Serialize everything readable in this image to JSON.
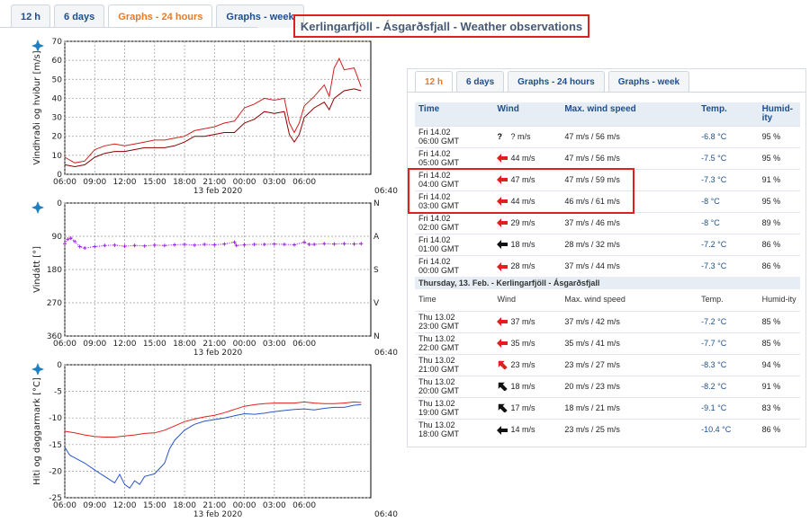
{
  "top_tabs": [
    {
      "label": "12 h",
      "active": false
    },
    {
      "label": "6 days",
      "active": false
    },
    {
      "label": "Graphs - 24 hours",
      "active": true
    },
    {
      "label": "Graphs - week",
      "active": false
    }
  ],
  "page_title": "Kerlingarfjöll - Ásgarðsfjall - Weather observations",
  "x_ticks": [
    "06:00",
    "09:00",
    "12:00",
    "15:00",
    "18:00",
    "21:00",
    "00:00",
    "03:00",
    "06:00"
  ],
  "x_date": "13 feb 2020",
  "x_end": "06:40",
  "colors": {
    "wind_mean": "#8b0000",
    "wind_gust": "#d21f1f",
    "direction": "#a020f0",
    "temp": "#e0201e",
    "dewpoint": "#2a56c6",
    "accent": "#e47b2c",
    "link": "#1f4e8c"
  },
  "chart_data": [
    {
      "type": "line",
      "ylabel": "Vindhraði og hviður [m/s]",
      "ylim": [
        0,
        70
      ],
      "yticks": [
        0,
        10,
        20,
        30,
        40,
        50,
        60,
        70
      ],
      "grid": true,
      "series": [
        {
          "values": [
            [
              0,
              5
            ],
            [
              1,
              4
            ],
            [
              2,
              5
            ],
            [
              3,
              9
            ],
            [
              4,
              11
            ],
            [
              5,
              12
            ],
            [
              6,
              12
            ],
            [
              7,
              13
            ],
            [
              8,
              14
            ],
            [
              9,
              14
            ],
            [
              10,
              14
            ],
            [
              11,
              15
            ],
            [
              12,
              17
            ],
            [
              13,
              20
            ],
            [
              14,
              20
            ],
            [
              15,
              21
            ],
            [
              16,
              22
            ],
            [
              17,
              22
            ],
            [
              18,
              27
            ],
            [
              19,
              29
            ],
            [
              20,
              33
            ],
            [
              21,
              32
            ],
            [
              22,
              33
            ],
            [
              22.5,
              21
            ],
            [
              23,
              17
            ],
            [
              23.5,
              21
            ],
            [
              24,
              30
            ],
            [
              25,
              35
            ],
            [
              26,
              38
            ],
            [
              26.5,
              34
            ],
            [
              27,
              40
            ],
            [
              27.5,
              42
            ],
            [
              28,
              44
            ],
            [
              29,
              45
            ],
            [
              29.7,
              44
            ]
          ]
        },
        {
          "values": [
            [
              0,
              9
            ],
            [
              1,
              6
            ],
            [
              2,
              7
            ],
            [
              3,
              13
            ],
            [
              4,
              15
            ],
            [
              5,
              16
            ],
            [
              6,
              15
            ],
            [
              7,
              16
            ],
            [
              8,
              17
            ],
            [
              9,
              18
            ],
            [
              10,
              18
            ],
            [
              11,
              19
            ],
            [
              12,
              20
            ],
            [
              13,
              23
            ],
            [
              14,
              24
            ],
            [
              15,
              25
            ],
            [
              16,
              27
            ],
            [
              17,
              28
            ],
            [
              18,
              35
            ],
            [
              19,
              37
            ],
            [
              20,
              40
            ],
            [
              21,
              39
            ],
            [
              22,
              40
            ],
            [
              22.5,
              27
            ],
            [
              23,
              22
            ],
            [
              23.5,
              27
            ],
            [
              24,
              36
            ],
            [
              25,
              41
            ],
            [
              26,
              47
            ],
            [
              26.5,
              41
            ],
            [
              27,
              56
            ],
            [
              27.5,
              61
            ],
            [
              28,
              55
            ],
            [
              29,
              56
            ],
            [
              29.7,
              46
            ]
          ]
        }
      ]
    },
    {
      "type": "scatter",
      "ylabel": "Vindátt [°]",
      "ylim": [
        360,
        0
      ],
      "yticks": [
        0,
        90,
        180,
        270,
        360
      ],
      "y2ticks": [
        "N",
        "A",
        "S",
        "V",
        "N"
      ],
      "grid": true,
      "series": [
        {
          "values": [
            [
              0,
              110
            ],
            [
              0.3,
              98
            ],
            [
              0.6,
              95
            ],
            [
              1,
              104
            ],
            [
              1.5,
              118
            ],
            [
              2,
              122
            ],
            [
              3,
              118
            ],
            [
              4,
              115
            ],
            [
              5,
              114
            ],
            [
              6,
              117
            ],
            [
              7,
              115
            ],
            [
              8,
              116
            ],
            [
              9,
              114
            ],
            [
              10,
              115
            ],
            [
              11,
              113
            ],
            [
              12,
              112
            ],
            [
              13,
              114
            ],
            [
              14,
              112
            ],
            [
              15,
              113
            ],
            [
              16,
              111
            ],
            [
              17,
              106
            ],
            [
              17.2,
              115
            ],
            [
              18,
              113
            ],
            [
              19,
              112
            ],
            [
              20,
              112
            ],
            [
              21,
              111
            ],
            [
              22,
              112
            ],
            [
              23,
              113
            ],
            [
              24,
              106
            ],
            [
              24.5,
              112
            ],
            [
              25,
              112
            ],
            [
              26,
              110
            ],
            [
              27,
              111
            ],
            [
              28,
              110
            ],
            [
              29,
              111
            ],
            [
              29.7,
              110
            ]
          ]
        }
      ]
    },
    {
      "type": "line",
      "ylabel": "Hiti og daggarmark [°C]",
      "ylim": [
        -25,
        0
      ],
      "yticks": [
        -25,
        -20,
        -15,
        -10,
        -5,
        0
      ],
      "grid": true,
      "series": [
        {
          "values": [
            [
              0,
              -12.5
            ],
            [
              1,
              -12.8
            ],
            [
              2,
              -13.2
            ],
            [
              3,
              -13.5
            ],
            [
              4,
              -13.6
            ],
            [
              5,
              -13.6
            ],
            [
              6,
              -13.4
            ],
            [
              7,
              -13.2
            ],
            [
              8,
              -12.9
            ],
            [
              9,
              -12.8
            ],
            [
              10,
              -12.3
            ],
            [
              11,
              -11.5
            ],
            [
              12,
              -10.7
            ],
            [
              13,
              -10.2
            ],
            [
              14,
              -9.8
            ],
            [
              15,
              -9.5
            ],
            [
              16,
              -9.0
            ],
            [
              17,
              -8.4
            ],
            [
              18,
              -7.8
            ],
            [
              19,
              -7.5
            ],
            [
              20,
              -7.3
            ],
            [
              21,
              -7.2
            ],
            [
              22,
              -7.2
            ],
            [
              23,
              -7.2
            ],
            [
              24,
              -7.0
            ],
            [
              25,
              -7.2
            ],
            [
              26,
              -7.3
            ],
            [
              27,
              -7.3
            ],
            [
              28,
              -7.2
            ],
            [
              29,
              -7.0
            ],
            [
              29.7,
              -7.1
            ]
          ]
        },
        {
          "values": [
            [
              0,
              -15.5
            ],
            [
              0.5,
              -17.0
            ],
            [
              1,
              -17.5
            ],
            [
              2,
              -18.5
            ],
            [
              3,
              -19.8
            ],
            [
              4,
              -21.0
            ],
            [
              5,
              -22.2
            ],
            [
              5.5,
              -20.6
            ],
            [
              6,
              -22.5
            ],
            [
              6.5,
              -23.2
            ],
            [
              7,
              -21.8
            ],
            [
              7.5,
              -22.5
            ],
            [
              8,
              -21.0
            ],
            [
              9,
              -20.5
            ],
            [
              10,
              -18.5
            ],
            [
              10.5,
              -15.8
            ],
            [
              11,
              -14.2
            ],
            [
              12,
              -12.3
            ],
            [
              13,
              -11.2
            ],
            [
              14,
              -10.6
            ],
            [
              15,
              -10.3
            ],
            [
              16,
              -10.0
            ],
            [
              17,
              -9.6
            ],
            [
              18,
              -9.2
            ],
            [
              19,
              -9.3
            ],
            [
              20,
              -9.1
            ],
            [
              21,
              -8.8
            ],
            [
              22,
              -8.6
            ],
            [
              23,
              -8.4
            ],
            [
              24,
              -8.3
            ],
            [
              25,
              -8.5
            ],
            [
              26,
              -8.2
            ],
            [
              27,
              -8.0
            ],
            [
              28,
              -8.0
            ],
            [
              29,
              -7.6
            ],
            [
              29.7,
              -7.5
            ]
          ]
        }
      ]
    }
  ],
  "panel": {
    "tabs": [
      {
        "label": "12 h",
        "active": true
      },
      {
        "label": "6 days",
        "active": false
      },
      {
        "label": "Graphs - 24 hours",
        "active": false
      },
      {
        "label": "Graphs - week",
        "active": false
      }
    ],
    "headers": {
      "time": "Time",
      "wind": "Wind",
      "max": "Max. wind speed",
      "temp": "Temp.",
      "humid": "Humid-ity"
    },
    "rows": [
      {
        "d": "Fri 14.02",
        "t": "06:00 GMT",
        "arrow": "unknown",
        "wind": "? m/s",
        "max": "47 m/s  /  56 m/s",
        "temp": "-6.8 °C",
        "hum": "95 %"
      },
      {
        "d": "Fri 14.02",
        "t": "05:00 GMT",
        "arrow": "red",
        "wind": "44 m/s",
        "max": "47 m/s  /  56 m/s",
        "temp": "-7.5 °C",
        "hum": "95 %"
      },
      {
        "d": "Fri 14.02",
        "t": "04:00 GMT",
        "arrow": "red",
        "wind": "47 m/s",
        "max": "47 m/s  /  59 m/s",
        "temp": "-7.3 °C",
        "hum": "91 %"
      },
      {
        "d": "Fri 14.02",
        "t": "03:00 GMT",
        "arrow": "red",
        "wind": "44 m/s",
        "max": "46 m/s  /  61 m/s",
        "temp": "-8 °C",
        "hum": "95 %"
      },
      {
        "d": "Fri 14.02",
        "t": "02:00 GMT",
        "arrow": "red",
        "wind": "29 m/s",
        "max": "37 m/s  /  46 m/s",
        "temp": "-8 °C",
        "hum": "89 %"
      },
      {
        "d": "Fri 14.02",
        "t": "01:00 GMT",
        "arrow": "black",
        "wind": "18 m/s",
        "max": "28 m/s  /  32 m/s",
        "temp": "-7.2 °C",
        "hum": "86 %"
      },
      {
        "d": "Fri 14.02",
        "t": "00:00 GMT",
        "arrow": "red",
        "wind": "28 m/s",
        "max": "37 m/s  /  44 m/s",
        "temp": "-7.3 °C",
        "hum": "86 %"
      }
    ],
    "section_title": "Thursday, 13. Feb. - Kerlingarfjöll - Ásgarðsfjall",
    "subheaders": {
      "time": "Time",
      "wind": "Wind",
      "max": "Max. wind speed",
      "temp": "Temp.",
      "humid": "Humid-ity"
    },
    "rows2": [
      {
        "d": "Thu 13.02",
        "t": "23:00 GMT",
        "arrow": "red",
        "wind": "37 m/s",
        "max": "37 m/s  /  42 m/s",
        "temp": "-7.2 °C",
        "hum": "85 %"
      },
      {
        "d": "Thu 13.02",
        "t": "22:00 GMT",
        "arrow": "red",
        "wind": "35 m/s",
        "max": "35 m/s  /  41 m/s",
        "temp": "-7.7 °C",
        "hum": "85 %"
      },
      {
        "d": "Thu 13.02",
        "t": "21:00 GMT",
        "arrow": "red-ne",
        "wind": "23 m/s",
        "max": "23 m/s  /  27 m/s",
        "temp": "-8.3 °C",
        "hum": "94 %"
      },
      {
        "d": "Thu 13.02",
        "t": "20:00 GMT",
        "arrow": "black-ne",
        "wind": "18 m/s",
        "max": "20 m/s  /  23 m/s",
        "temp": "-8.2 °C",
        "hum": "91 %"
      },
      {
        "d": "Thu 13.02",
        "t": "19:00 GMT",
        "arrow": "black-ne",
        "wind": "17 m/s",
        "max": "18 m/s  /  21 m/s",
        "temp": "-9.1 °C",
        "hum": "83 %"
      },
      {
        "d": "Thu 13.02",
        "t": "18:00 GMT",
        "arrow": "black",
        "wind": "14 m/s",
        "max": "23 m/s  /  25 m/s",
        "temp": "-10.4 °C",
        "hum": "86 %"
      }
    ]
  }
}
